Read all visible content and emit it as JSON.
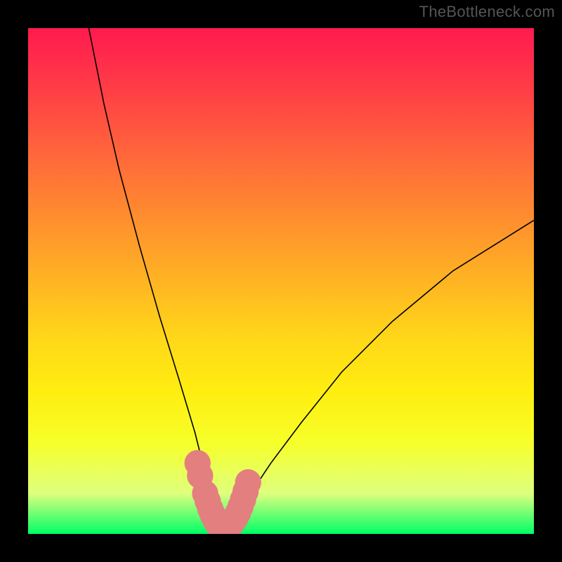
{
  "watermark": "TheBottleneck.com",
  "chart_data": {
    "type": "line",
    "title": "",
    "xlabel": "",
    "ylabel": "",
    "xlim": [
      0,
      100
    ],
    "ylim": [
      0,
      100
    ],
    "background_gradient": {
      "top": "#ff1a4f",
      "mid": "#ffee10",
      "bottom": "#00ff66"
    },
    "curve": {
      "description": "V-shaped bottleneck curve; minimum near x≈38 at y≈0; left branch rises steeply to y=100 at x≈12; right branch rises more gently to y≈62 at x=100",
      "samples_x": [
        12,
        15,
        18,
        22,
        26,
        30,
        33,
        35,
        37,
        38,
        39,
        41,
        44,
        48,
        54,
        62,
        72,
        84,
        100
      ],
      "samples_y": [
        100,
        85,
        72,
        57,
        43,
        30,
        20,
        12,
        4,
        1,
        2,
        4,
        8,
        14,
        22,
        32,
        42,
        52,
        62
      ]
    },
    "markers": {
      "color": "#e37f7f",
      "radius": 2.6,
      "points_x": [
        33.5,
        34.0,
        35.0,
        35.5,
        36.0,
        36.5,
        37.0,
        37.5,
        38.0,
        38.5,
        39.0,
        39.5,
        40.0,
        40.5,
        41.0,
        41.5,
        42.0,
        42.5,
        43.0,
        43.5
      ],
      "points_y": [
        14.0,
        11.5,
        8.0,
        6.5,
        5.0,
        3.8,
        2.8,
        2.0,
        1.4,
        1.2,
        1.2,
        1.4,
        1.8,
        2.4,
        3.2,
        4.2,
        5.4,
        6.8,
        8.4,
        10.2
      ]
    }
  }
}
